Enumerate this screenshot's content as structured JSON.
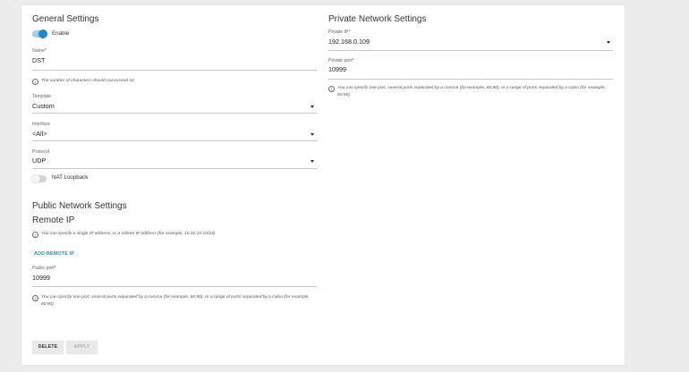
{
  "general": {
    "title": "General Settings",
    "enable_label": "Enable",
    "name_label": "Name*",
    "name_value": "DST",
    "name_hint": "The number of characters should not exceed 32",
    "template_label": "Template",
    "template_value": "Custom",
    "interface_label": "Interface",
    "interface_value": "<All>",
    "protocol_label": "Protocol",
    "protocol_value": "UDP",
    "nat_loopback_label": "NAT Loopback"
  },
  "public": {
    "title": "Public Network Settings",
    "remote_ip_title": "Remote IP",
    "remote_ip_hint": "You can specify a single IP address, or a subnet IP address (for example, 10.10.10.10/24)",
    "add_remote_ip": "ADD REMOTE IP",
    "port_label": "Public port*",
    "port_value": "10999",
    "port_hint": "You can specify one port, several ports separated by a comma (for example, 80,90), or a range of ports separated by a colon (for example, 80:90)"
  },
  "private": {
    "title": "Private Network Settings",
    "ip_label": "Private IP*",
    "ip_value": "192.168.0.109",
    "port_label": "Private port*",
    "port_value": "10999",
    "port_hint": "You can specify one port, several ports separated by a comma (for example, 80,90), or a range of ports separated by a colon (for example, 80:90)"
  },
  "actions": {
    "delete_label": "DELETE",
    "apply_label": "APPLY"
  },
  "toggles": {
    "enable": "on",
    "nat_loopback": "off"
  },
  "icons": {
    "info": "info-icon",
    "dropdown": "chevron-down-icon"
  },
  "colors": {
    "accent": "#1e88c8",
    "link": "#2a8fc6",
    "background": "#ececec",
    "card": "#ffffff"
  }
}
